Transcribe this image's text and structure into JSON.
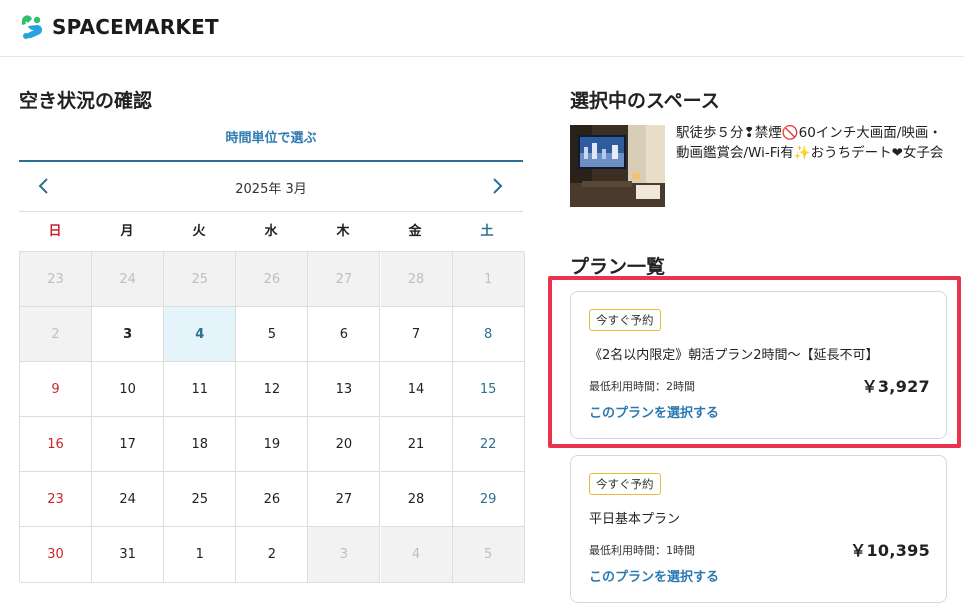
{
  "header": {
    "logo_text": "SPACEMARKET"
  },
  "availability": {
    "heading": "空き状況の確認",
    "tab_label": "時間単位で選ぶ",
    "month_label": "2025年 3月",
    "weekdays": [
      "日",
      "月",
      "火",
      "水",
      "木",
      "金",
      "土"
    ],
    "days": [
      [
        "23",
        "24",
        "25",
        "26",
        "27",
        "28",
        "1"
      ],
      [
        "2",
        "3",
        "4",
        "5",
        "6",
        "7",
        "8"
      ],
      [
        "9",
        "10",
        "11",
        "12",
        "13",
        "14",
        "15"
      ],
      [
        "16",
        "17",
        "18",
        "19",
        "20",
        "21",
        "22"
      ],
      [
        "23",
        "24",
        "25",
        "26",
        "27",
        "28",
        "29"
      ],
      [
        "30",
        "31",
        "1",
        "2",
        "3",
        "4",
        "5"
      ]
    ]
  },
  "selected_space": {
    "heading": "選択中のスペース",
    "title": "駅徒歩５分❢禁煙🚫60インチ大画面/映画・動画鑑賞会/Wi-Fi有✨おうちデート❤女子会"
  },
  "plans": {
    "heading": "プラン一覧",
    "items": [
      {
        "badge": "今すぐ予約",
        "name": "《2名以内限定》朝活プラン2時間〜【延長不可】",
        "min_time": "最低利用時間：2時間",
        "price": "￥3,927",
        "link": "このプランを選択する"
      },
      {
        "badge": "今すぐ予約",
        "name": "平日基本プラン",
        "min_time": "最低利用時間：1時間",
        "price": "￥10,395",
        "link": "このプランを選択する"
      }
    ]
  },
  "colors": {
    "accent_blue": "#2b79b0",
    "sunday_red": "#c9272f",
    "saturday_blue": "#2c6f91",
    "highlight_red": "#e8344e",
    "badge_border": "#e8b93a"
  }
}
